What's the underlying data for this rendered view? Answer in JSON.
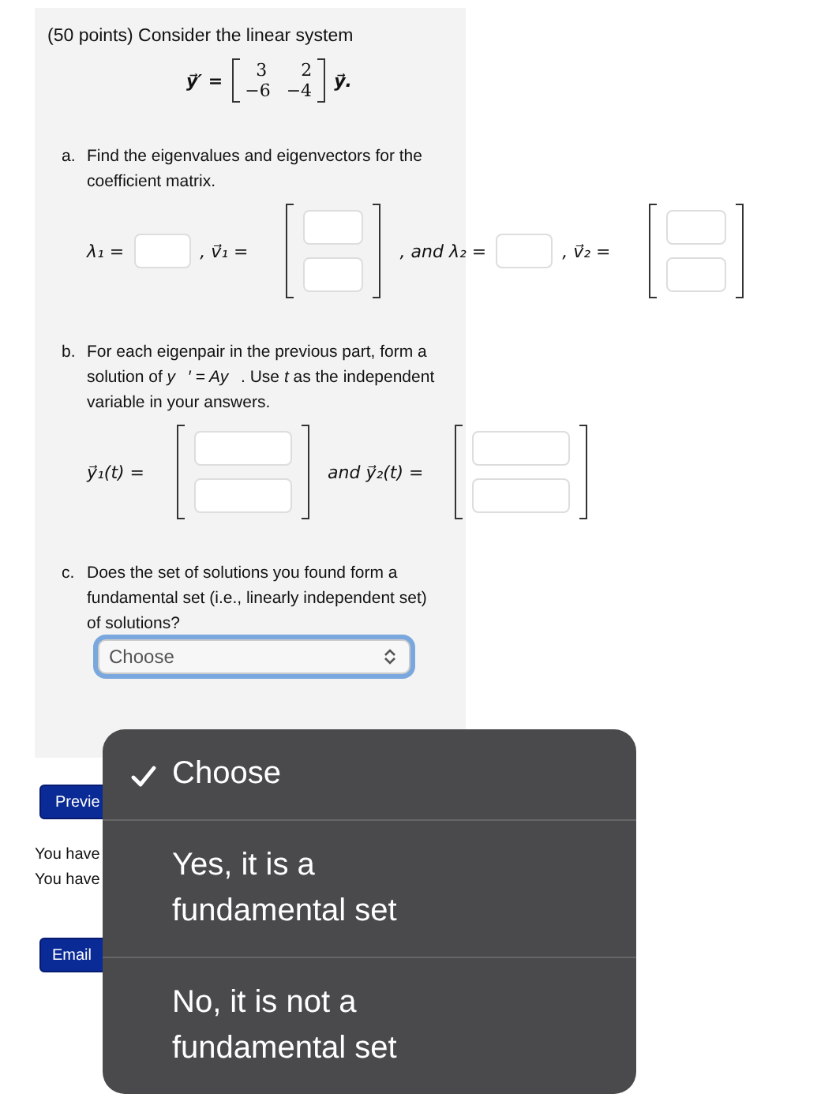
{
  "problem": {
    "title": "(50 points) Consider the linear system",
    "equation": {
      "lhs": "y⃗′ =",
      "matrix": [
        [
          "3",
          "2"
        ],
        [
          "−6",
          "−4"
        ]
      ],
      "rhs": "y⃗."
    },
    "parts": [
      {
        "label": "a.",
        "text": "Find the eigenvalues and eigenvectors for the coefficient matrix.",
        "row": [
          {
            "kind": "label",
            "text": "λ₁ ="
          },
          {
            "kind": "input"
          },
          {
            "kind": "label",
            "text": ", v⃗₁ ="
          },
          {
            "kind": "vector"
          },
          {
            "kind": "label",
            "text": ", and λ₂ ="
          },
          {
            "kind": "input"
          },
          {
            "kind": "label",
            "text": ", v⃗₂ ="
          },
          {
            "kind": "vector"
          }
        ]
      },
      {
        "label": "b.",
        "text": "For each eigenpair in the previous part, form a solution of *y⃗′ = Ay⃗*. Use *t* as the independent variable in your answers.",
        "row": [
          {
            "kind": "label",
            "text": "y⃗₁(t) ="
          },
          {
            "kind": "vector"
          },
          {
            "kind": "label",
            "text": "and y⃗₂(t) ="
          },
          {
            "kind": "vector"
          }
        ]
      },
      {
        "label": "c.",
        "text": "Does the set of solutions you found form a fundamental set (i.e., linearly independent set) of solutions?",
        "select": {
          "value": "Choose",
          "focused": true
        }
      }
    ]
  },
  "buttons": [
    {
      "label": "Previe"
    },
    {
      "label": "Email"
    }
  ],
  "messages": [
    "You have",
    "You have"
  ],
  "menu": {
    "options": [
      {
        "label": "Choose",
        "selected": true
      },
      {
        "label": "Yes, it is a fundamental set",
        "selected": false
      },
      {
        "label": "No, it is not a fundamental set",
        "selected": false
      }
    ]
  }
}
